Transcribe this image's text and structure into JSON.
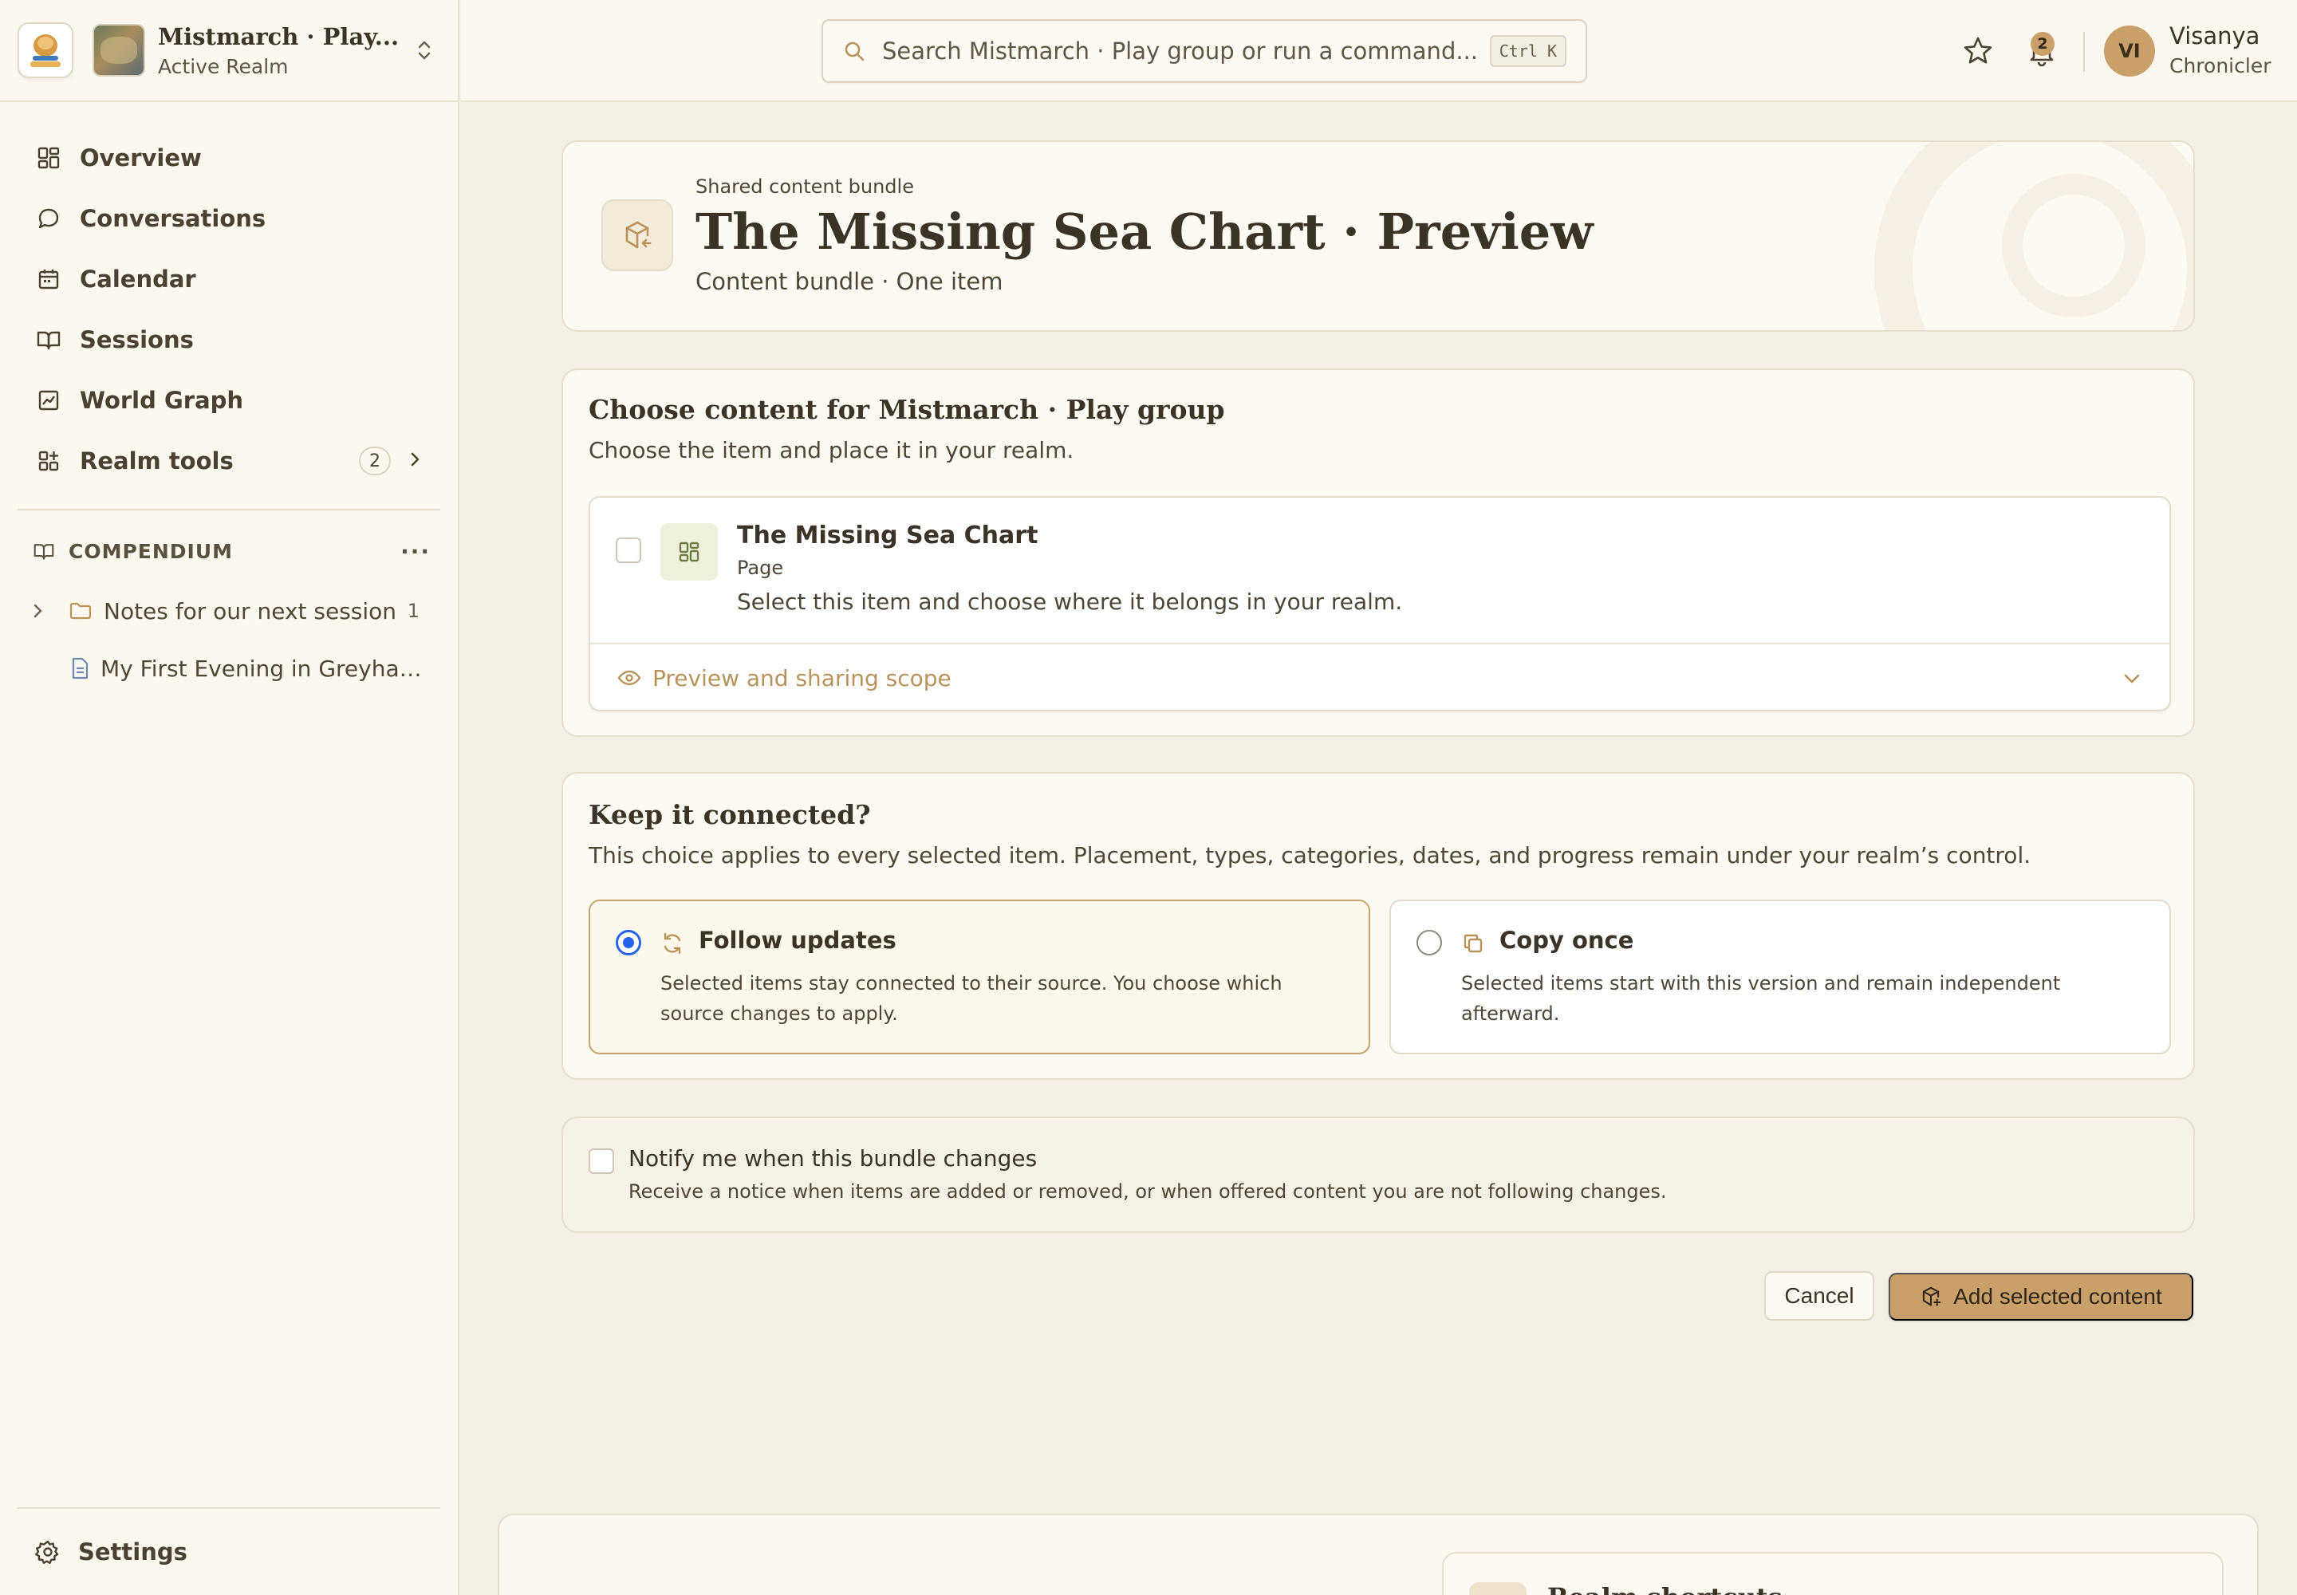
{
  "realm": {
    "name": "Mistmarch · Play...",
    "status": "Active Realm"
  },
  "nav": {
    "items": [
      {
        "label": "Overview"
      },
      {
        "label": "Conversations"
      },
      {
        "label": "Calendar"
      },
      {
        "label": "Sessions"
      },
      {
        "label": "World Graph"
      },
      {
        "label": "Realm tools",
        "badge": "2"
      }
    ]
  },
  "compendium": {
    "heading": "COMPENDIUM",
    "more": "···",
    "folder": {
      "label": "Notes for our next session",
      "count": "1"
    },
    "doc": {
      "label": "My First Evening in Greyhaven"
    }
  },
  "settings": {
    "label": "Settings"
  },
  "search": {
    "placeholder": "Search Mistmarch · Play group or run a command...",
    "shortcut": "Ctrl K"
  },
  "notifications": {
    "count": "2"
  },
  "user": {
    "initials": "VI",
    "name": "Visanya",
    "role": "Chronicler"
  },
  "header": {
    "kicker": "Shared content bundle",
    "title": "The Missing Sea Chart · Preview",
    "subtitle": "Content bundle · One item"
  },
  "choose": {
    "title": "Choose content for Mistmarch · Play group",
    "subtitle": "Choose the item and place it in your realm.",
    "item": {
      "title": "The Missing Sea Chart",
      "type": "Page",
      "description": "Select this item and choose where it belongs in your realm.",
      "checked": false
    },
    "preview_label": "Preview and sharing scope"
  },
  "connection": {
    "title": "Keep it connected?",
    "subtitle": "This choice applies to every selected item. Placement, types, categories, dates, and progress remain under your realm’s control.",
    "options": [
      {
        "title": "Follow updates",
        "description": "Selected items stay connected to their source. You choose which source changes to apply.",
        "selected": true
      },
      {
        "title": "Copy once",
        "description": "Selected items start with this version and remain independent afterward.",
        "selected": false
      }
    ]
  },
  "notify": {
    "label": "Notify me when this bundle changes",
    "description": "Receive a notice when items are added or removed, or when offered content you are not following changes.",
    "checked": false
  },
  "actions": {
    "cancel": "Cancel",
    "add": "Add selected content"
  },
  "shortcuts": {
    "title": "Realm shortcuts"
  },
  "colors": {
    "accent": "#c9a06a",
    "radio": "#2563eb",
    "background": "#f3efe4",
    "panel": "#fdfaf3"
  }
}
